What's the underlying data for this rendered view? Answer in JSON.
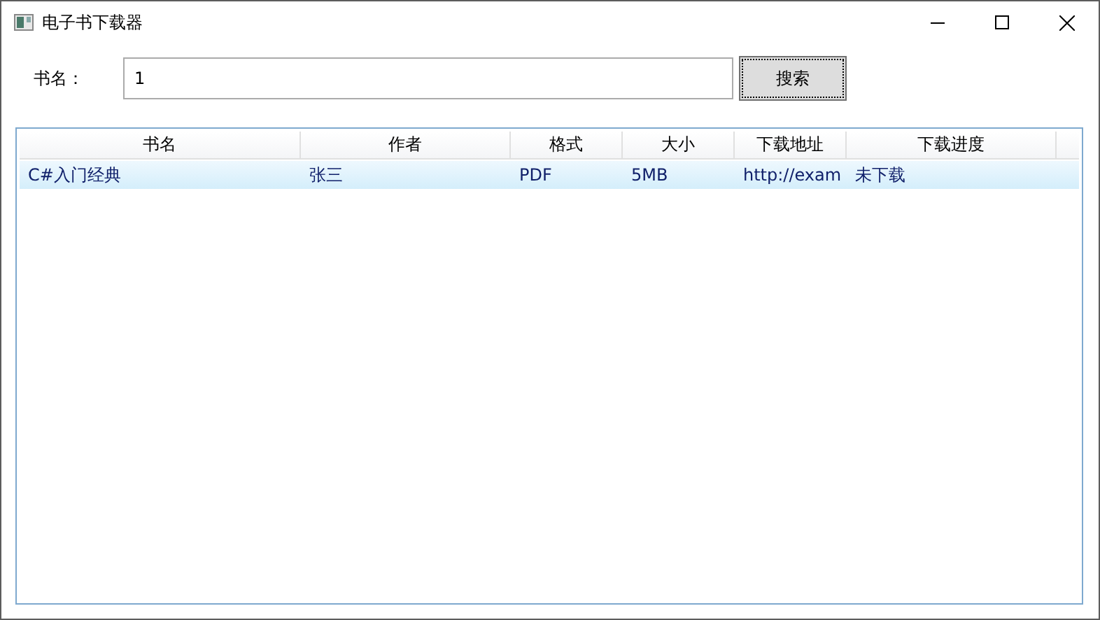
{
  "window": {
    "title": "电子书下载器"
  },
  "search": {
    "label": "书名：",
    "value": "1",
    "button": "搜索"
  },
  "table": {
    "columns": [
      "书名",
      "作者",
      "格式",
      "大小",
      "下载地址",
      "下载进度"
    ],
    "rows": [
      {
        "cells": [
          "C#入门经典",
          "张三",
          "PDF",
          "5MB",
          "http://exam",
          "未下载"
        ],
        "selected": true
      }
    ]
  }
}
